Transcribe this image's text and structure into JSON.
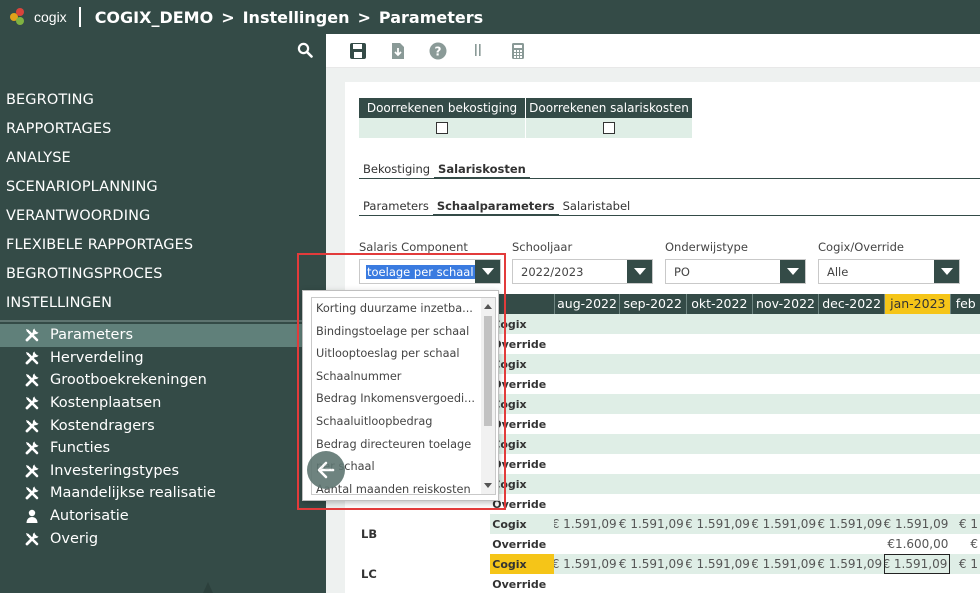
{
  "header": {
    "logo_text": "cogix",
    "breadcrumb": [
      "COGIX_DEMO",
      "Instellingen",
      "Parameters"
    ],
    "separator": ">"
  },
  "sidebar": {
    "main_items": [
      {
        "label": "BEGROTING"
      },
      {
        "label": "RAPPORTAGES"
      },
      {
        "label": "ANALYSE"
      },
      {
        "label": "SCENARIOPLANNING"
      },
      {
        "label": "VERANTWOORDING"
      },
      {
        "label": "FLEXIBELE RAPPORTAGES"
      },
      {
        "label": "BEGROTINGSPROCES"
      },
      {
        "label": "INSTELLINGEN"
      }
    ],
    "sub_items": [
      {
        "label": "Parameters",
        "icon": "tools-icon",
        "active": true
      },
      {
        "label": "Herverdeling",
        "icon": "tools-icon"
      },
      {
        "label": "Grootboekrekeningen",
        "icon": "tools-icon"
      },
      {
        "label": "Kostenplaatsen",
        "icon": "tools-icon"
      },
      {
        "label": "Kostendragers",
        "icon": "tools-icon"
      },
      {
        "label": "Functies",
        "icon": "tools-icon"
      },
      {
        "label": "Investeringstypes",
        "icon": "tools-icon"
      },
      {
        "label": "Maandelijkse realisatie",
        "icon": "tools-icon"
      },
      {
        "label": "Autorisatie",
        "icon": "user-icon"
      },
      {
        "label": "Overig",
        "icon": "tools-icon"
      }
    ]
  },
  "toolbar": {
    "icons": [
      "save-icon",
      "download-icon",
      "help-icon",
      "pause-icon",
      "calculator-icon"
    ]
  },
  "recalc": {
    "columns": [
      "Doorrekenen bekostiging",
      "Doorrekenen salariskosten"
    ]
  },
  "tabs_level1": [
    {
      "label": "Bekostiging",
      "active": false
    },
    {
      "label": "Salariskosten",
      "active": true
    }
  ],
  "tabs_level2": [
    {
      "label": "Parameters",
      "active": false
    },
    {
      "label": "Schaalparameters",
      "active": true
    },
    {
      "label": "Salaristabel",
      "active": false
    }
  ],
  "filters": {
    "salaris_component": {
      "label": "Salaris Component",
      "value": "toelage per schaal"
    },
    "schooljaar": {
      "label": "Schooljaar",
      "value": "2022/2023"
    },
    "onderwijstype": {
      "label": "Onderwijstype",
      "value": "PO"
    },
    "override": {
      "label": "Cogix/Override",
      "value": "Alle"
    }
  },
  "dropdown": {
    "options": [
      "Korting duurzame inzetba...",
      "Bindingstoelage per schaal",
      "Uitlooptoeslag per schaal",
      "Schaalnummer",
      "Bedrag Inkomensvergoedi...",
      "Schaaluitloopbedrag",
      "Bedrag directeuren toelage",
      "per schaal",
      "Aantal maanden reiskosten"
    ]
  },
  "grid": {
    "months": [
      {
        "label": "aug-2022",
        "highlight": false
      },
      {
        "label": "sep-2022",
        "highlight": false
      },
      {
        "label": "okt-2022",
        "highlight": false
      },
      {
        "label": "nov-2022",
        "highlight": false
      },
      {
        "label": "dec-2022",
        "highlight": false
      },
      {
        "label": "jan-2023",
        "highlight": true
      },
      {
        "label": "feb",
        "highlight": false
      }
    ],
    "rows": [
      {
        "label": "",
        "type": "Cogix",
        "values": [
          "",
          "",
          "",
          "",
          "",
          "",
          ""
        ]
      },
      {
        "label": "",
        "type": "Override",
        "values": [
          "",
          "",
          "",
          "",
          "",
          "",
          ""
        ]
      },
      {
        "label": "",
        "type": "Cogix",
        "values": [
          "",
          "",
          "",
          "",
          "",
          "",
          ""
        ]
      },
      {
        "label": "",
        "type": "Override",
        "values": [
          "",
          "",
          "",
          "",
          "",
          "",
          ""
        ]
      },
      {
        "label": "",
        "type": "Cogix",
        "values": [
          "",
          "",
          "",
          "",
          "",
          "",
          ""
        ]
      },
      {
        "label": "",
        "type": "Override",
        "values": [
          "",
          "",
          "",
          "",
          "",
          "",
          ""
        ]
      },
      {
        "label": "",
        "type": "Cogix",
        "values": [
          "",
          "",
          "",
          "",
          "",
          "",
          ""
        ]
      },
      {
        "label": "",
        "type": "Override",
        "values": [
          "",
          "",
          "",
          "",
          "",
          "",
          ""
        ]
      },
      {
        "label": "",
        "type": "Cogix",
        "values": [
          "",
          "",
          "",
          "",
          "",
          "",
          ""
        ]
      },
      {
        "label": "",
        "type": "Override",
        "values": [
          "",
          "",
          "",
          "",
          "",
          "",
          ""
        ]
      },
      {
        "label": "LB",
        "type": "Cogix",
        "values": [
          "€ 1.591,09",
          "€ 1.591,09",
          "€ 1.591,09",
          "€ 1.591,09",
          "€ 1.591,09",
          "€ 1.591,09",
          "€ 1"
        ]
      },
      {
        "label": "",
        "type": "Override",
        "values": [
          "",
          "",
          "",
          "",
          "",
          "€1.600,00",
          "€"
        ]
      },
      {
        "label": "LC",
        "type": "Cogix",
        "values": [
          "€ 1.591,09",
          "€ 1.591,09",
          "€ 1.591,09",
          "€ 1.591,09",
          "€ 1.591,09",
          "€ 1.591,09",
          "€ 1"
        ],
        "type_highlight": true,
        "boxed_col": 5
      },
      {
        "label": "",
        "type": "Override",
        "values": [
          "",
          "",
          "",
          "",
          "",
          "",
          ""
        ]
      }
    ]
  },
  "colors": {
    "sidebar_bg": "#344b47",
    "accent_yellow": "#f5c518",
    "row_tint": "#dfeee6",
    "highlight_red": "#e23b3b"
  }
}
